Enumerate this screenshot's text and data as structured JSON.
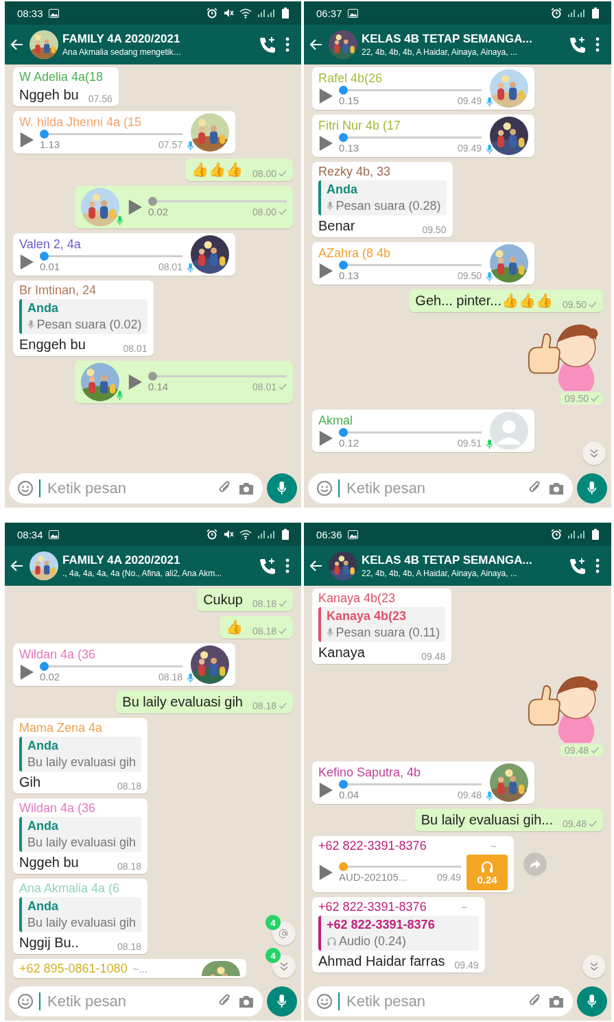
{
  "panels": [
    {
      "status_time": "08:33",
      "sound_muted": true,
      "wifi_on": true,
      "title": "FAMILY 4A 2020/2021",
      "subtitle": "Ana Akmalia sedang mengetik…",
      "messages": [
        {
          "kind": "text",
          "outgoing": false,
          "sender": "W Adelia 4a(18",
          "color": "#4caf50",
          "text": "Nggeh bu",
          "time": "07.56"
        },
        {
          "kind": "voice",
          "outgoing": false,
          "sender": "W. hilda Jhenni 4a (15",
          "color": "#f4a26b",
          "duration": "1.13",
          "time": "07.57",
          "level": 0,
          "played": true
        },
        {
          "kind": "text",
          "outgoing": true,
          "text": "👍👍👍",
          "time": "08.00"
        },
        {
          "kind": "voice",
          "outgoing": true,
          "duration": "0.02",
          "time": "08.00",
          "level": 0
        },
        {
          "kind": "voice",
          "outgoing": false,
          "sender": "Valen 2, 4a",
          "color": "#6a5acd",
          "duration": "0.01",
          "time": "08.01",
          "level": 0,
          "played": true
        },
        {
          "kind": "reply",
          "outgoing": false,
          "sender": "Br Imtinan, 24",
          "color": "#b07a5a",
          "quote": {
            "name": "Anda",
            "color": "#128c7e",
            "kind": "voice",
            "text": "Pesan suara (0.02)"
          },
          "text": "Enggeh bu",
          "time": "08.01"
        },
        {
          "kind": "voice",
          "outgoing": true,
          "duration": "0.14",
          "time": "08.01",
          "level": 0
        }
      ],
      "placeholder": "Ketik pesan"
    },
    {
      "status_time": "06:37",
      "sound_muted": false,
      "wifi_on": false,
      "title": "KELAS 4B TETAP SEMANGA...",
      "subtitle": "22, 4b, 4b, 4b, A Haidar, Ainaya, Ainaya, ...",
      "messages": [
        {
          "kind": "voice",
          "outgoing": false,
          "sender": "Rafel 4b(26",
          "color": "#a8b83a",
          "duration": "0.15",
          "time": "09.49",
          "level": 0,
          "played": true
        },
        {
          "kind": "voice",
          "outgoing": false,
          "sender": "Fitri Nur 4b (17",
          "color": "#a8b83a",
          "duration": "0.13",
          "time": "09.49",
          "level": 0,
          "played": true
        },
        {
          "kind": "reply",
          "outgoing": false,
          "sender": "Rezky 4b, 33",
          "color": "#a06a50",
          "quote": {
            "name": "Anda",
            "color": "#128c7e",
            "kind": "voice",
            "text": "Pesan suara (0.28)"
          },
          "text": "Benar",
          "time": "09.50"
        },
        {
          "kind": "voice",
          "outgoing": false,
          "sender": "AZahra (8 4b",
          "color": "#f0a030",
          "duration": "0.13",
          "time": "09.50",
          "level": 0,
          "played": true
        },
        {
          "kind": "text",
          "outgoing": true,
          "text": "Geh... pinter...👍👍👍",
          "time": "09.50"
        },
        {
          "kind": "sticker",
          "outgoing": true,
          "time": "09.50"
        },
        {
          "kind": "voice",
          "outgoing": false,
          "sender": "Akmal",
          "color": "#4caf50",
          "duration": "0.12",
          "time": "09.51",
          "level": 0,
          "played": false,
          "blank_avatar": true
        }
      ],
      "floating": [
        {
          "kind": "scroll"
        }
      ],
      "placeholder": "Ketik pesan"
    },
    {
      "status_time": "08:34",
      "sound_muted": true,
      "wifi_on": true,
      "title": "FAMILY 4A 2020/2021",
      "subtitle": "., 4a, 4a, 4a, 4a (No., Afina, ali2, Ana Akm...",
      "messages": [
        {
          "kind": "text",
          "outgoing": true,
          "text": "Cukup",
          "time": "08.18"
        },
        {
          "kind": "text",
          "outgoing": true,
          "text": "👍",
          "time": "08.18"
        },
        {
          "kind": "voice",
          "outgoing": false,
          "sender": "Wildan 4a (36",
          "color": "#e377c2",
          "duration": "0.02",
          "time": "08.18",
          "level": 0,
          "played": true
        },
        {
          "kind": "text",
          "outgoing": true,
          "text": "Bu laily evaluasi gih",
          "time": "08.18"
        },
        {
          "kind": "reply",
          "outgoing": false,
          "sender": "Mama Zena 4a",
          "color": "#f0a050",
          "quote": {
            "name": "Anda",
            "color": "#128c7e",
            "kind": "text",
            "text": "Bu laily evaluasi gih"
          },
          "text": "Gih",
          "time": "08.18"
        },
        {
          "kind": "reply",
          "outgoing": false,
          "sender": "Wildan 4a (36",
          "color": "#e377c2",
          "quote": {
            "name": "Anda",
            "color": "#128c7e",
            "kind": "text",
            "text": "Bu laily evaluasi gih"
          },
          "text": "Nggeh bu",
          "time": "08.18"
        },
        {
          "kind": "reply",
          "outgoing": false,
          "sender": "Ana Akmalia 4a (6",
          "color": "#8fd3c0",
          "quote": {
            "name": "Anda",
            "color": "#128c7e",
            "kind": "text",
            "text": "Bu laily evaluasi gih"
          },
          "text": "Nggij Bu..",
          "time": "08.18"
        },
        {
          "kind": "cut",
          "outgoing": false,
          "sender": "+62 895-0861-1080",
          "color": "#d4b020",
          "tilde": "~..."
        }
      ],
      "floating": [
        {
          "kind": "mention",
          "count": "4"
        },
        {
          "kind": "scroll",
          "count": "4"
        }
      ],
      "placeholder": "Ketik pesan"
    },
    {
      "status_time": "06:36",
      "sound_muted": false,
      "wifi_on": false,
      "title": "KELAS 4B TETAP SEMANGA...",
      "subtitle": "22, 4b, 4b, 4b, A Haidar, Ainaya, Ainaya, ...",
      "messages": [
        {
          "kind": "reply",
          "outgoing": false,
          "sender": "Kanaya 4b(23",
          "color": "#e0506a",
          "quote": {
            "name": "Kanaya 4b(23",
            "color": "#e0506a",
            "kind": "voice",
            "text": "Pesan suara (0.11)"
          },
          "text": "Kanaya",
          "time": "09.48"
        },
        {
          "kind": "sticker",
          "outgoing": true,
          "time": "09.48"
        },
        {
          "kind": "voice",
          "outgoing": false,
          "sender": "Kefino Saputra, 4b",
          "color": "#c0409a",
          "duration": "0.04",
          "time": "09.48",
          "level": 0,
          "played": true
        },
        {
          "kind": "text",
          "outgoing": true,
          "text": "Bu laily evaluasi gih...",
          "time": "09.48"
        },
        {
          "kind": "audio",
          "outgoing": false,
          "sender": "+62 822-3391-8376",
          "color": "#c0207a",
          "tilde": "~",
          "file": "AUD-202105...",
          "time": "09.49",
          "badge": "0.24",
          "level": 0,
          "forward": true
        },
        {
          "kind": "reply",
          "outgoing": false,
          "sender": "+62 822-3391-8376",
          "color": "#c0207a",
          "tilde": "~",
          "quote": {
            "name": "+62 822-3391-8376",
            "color": "#c0207a",
            "kind": "audio",
            "text": "Audio (0.24)"
          },
          "text": "Ahmad Haidar farras",
          "time": "09.49"
        }
      ],
      "floating": [
        {
          "kind": "scroll"
        }
      ],
      "placeholder": "Ketik pesan"
    }
  ]
}
